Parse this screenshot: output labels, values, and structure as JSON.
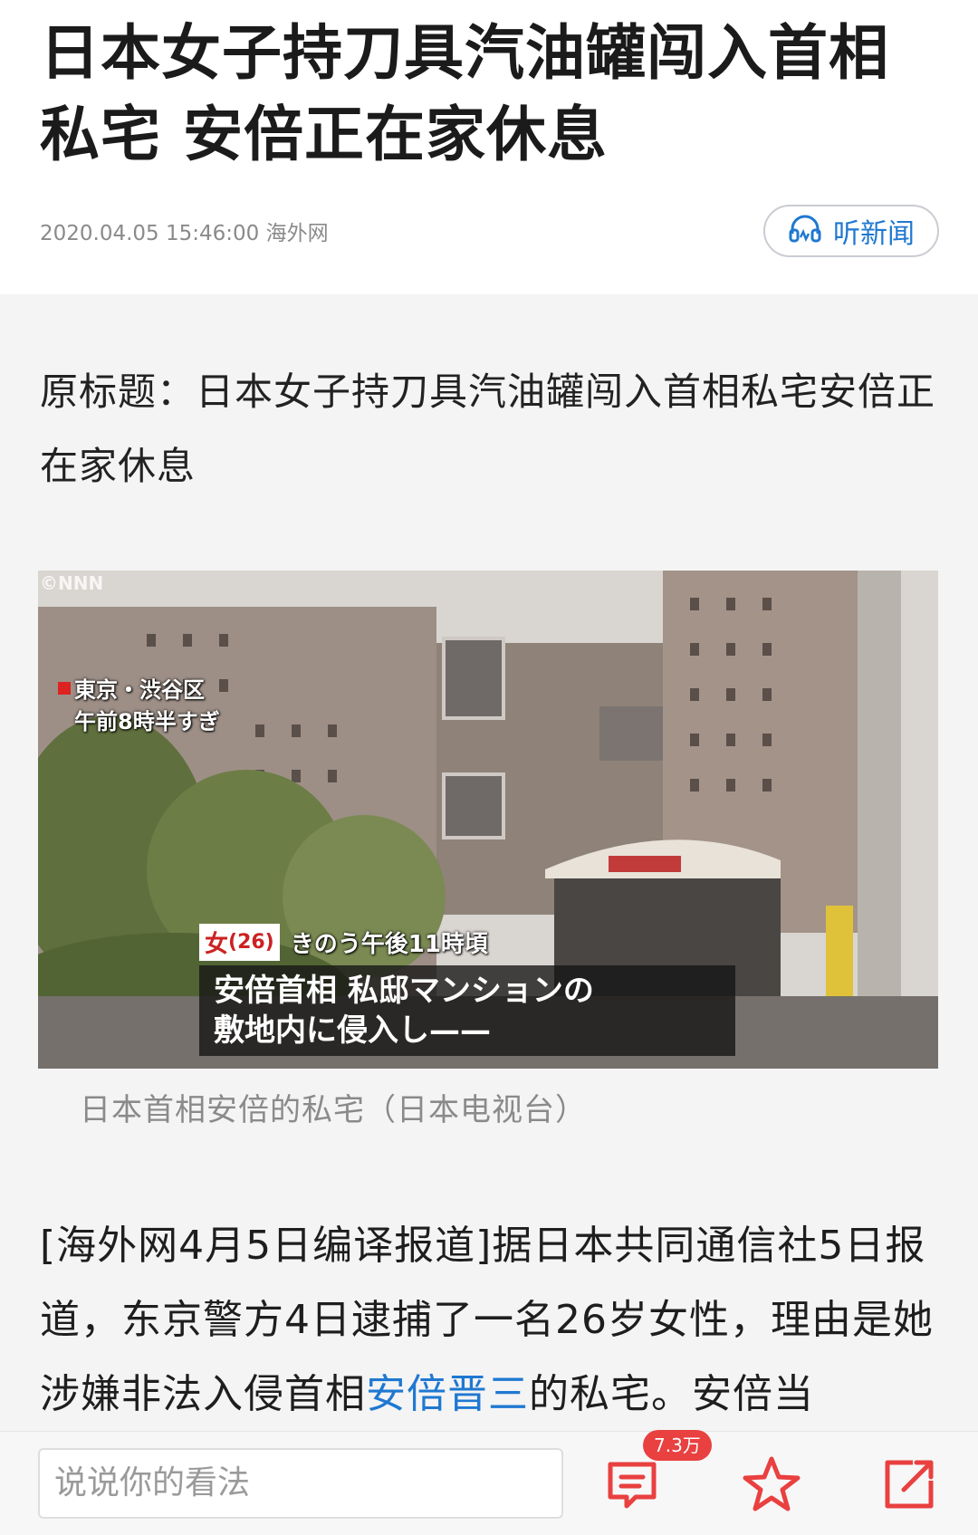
{
  "article": {
    "title": "日本女子持刀具汽油罐闯入首相私宅 安倍正在家休息",
    "timestamp": "2020.04.05 15:46:00",
    "source": "海外网",
    "listen_label": "听新闻",
    "original_title": "原标题：日本女子持刀具汽油罐闯入首相私宅安倍正在家休息",
    "image_caption": "日本首相安倍的私宅（日本电视台）",
    "body_part1": "[海外网4月5日编译报道]据日本共同通信社5日报道，东京警方4日逮捕了一名26岁女性，理由是她涉嫌非法入侵首相",
    "body_link": "安倍晋三",
    "body_part2": "的私宅。安倍当"
  },
  "photo_overlay": {
    "watermark": "©NNN",
    "location": "東京・渋谷区",
    "time": "午前8時半すぎ",
    "person_tag": "女",
    "person_age": "(26)",
    "when": "きのう午後11時頃",
    "headline_line1": "安倍首相 私邸マンションの",
    "headline_line2": "敷地内に侵入し——"
  },
  "bottom_bar": {
    "comment_placeholder": "说说你的看法",
    "comment_count": "7.3万",
    "icons": [
      "comment-icon",
      "star-icon",
      "share-icon"
    ]
  },
  "colors": {
    "accent": "#1f78d1",
    "badge": "#e94040",
    "icon_red": "#e94040"
  }
}
